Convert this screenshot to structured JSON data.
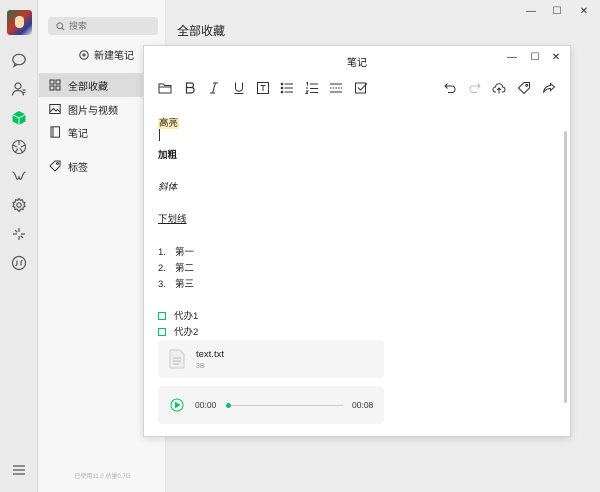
{
  "app": {
    "window_controls": {
      "minimize": "—",
      "maximize": "☐",
      "close": "✕"
    }
  },
  "sidebar": {
    "search_placeholder": "搜索",
    "new_note": "新建笔记",
    "items": [
      {
        "label": "全部收藏",
        "icon": "grid-icon",
        "active": true
      },
      {
        "label": "图片与视频",
        "icon": "image-icon",
        "active": false
      },
      {
        "label": "笔记",
        "icon": "notebook-icon",
        "active": false
      },
      {
        "label": "标签",
        "icon": "tag-icon",
        "active": false
      }
    ],
    "footer": "已使用11.0 总量0.7G"
  },
  "iconbar": {
    "icons": [
      "chat-icon",
      "contacts-icon",
      "favorites-icon",
      "moments-icon",
      "channels-icon",
      "settings-gear-icon",
      "discover-icon",
      "miniprogram-icon",
      "menu-icon"
    ],
    "accent": "#07c160"
  },
  "main": {
    "title": "全部收藏"
  },
  "note": {
    "title": "笔记",
    "controls": {
      "minimize": "—",
      "maximize": "☐",
      "close": "✕"
    },
    "toolbar_left": [
      "folder-icon",
      "bold-icon",
      "italic-icon",
      "underline-icon",
      "text-box-icon",
      "bullet-list-icon",
      "numbered-list-icon",
      "divider-icon",
      "checkbox-icon"
    ],
    "toolbar_right": [
      "undo-icon",
      "redo-icon",
      "cloud-upload-icon",
      "tag-icon",
      "share-icon"
    ],
    "highlight_text": "高亮",
    "bold_text": "加粗",
    "italic_text": "斜体",
    "underline_text": "下划线",
    "ordered": [
      {
        "num": "1.",
        "text": "第一"
      },
      {
        "num": "2.",
        "text": "第二"
      },
      {
        "num": "3.",
        "text": "第三"
      }
    ],
    "todos": [
      "代办1",
      "代办2"
    ],
    "file": {
      "name": "text.txt",
      "size": "3B"
    },
    "audio": {
      "current": "00:00",
      "total": "00:08",
      "progress": 0.0
    }
  }
}
